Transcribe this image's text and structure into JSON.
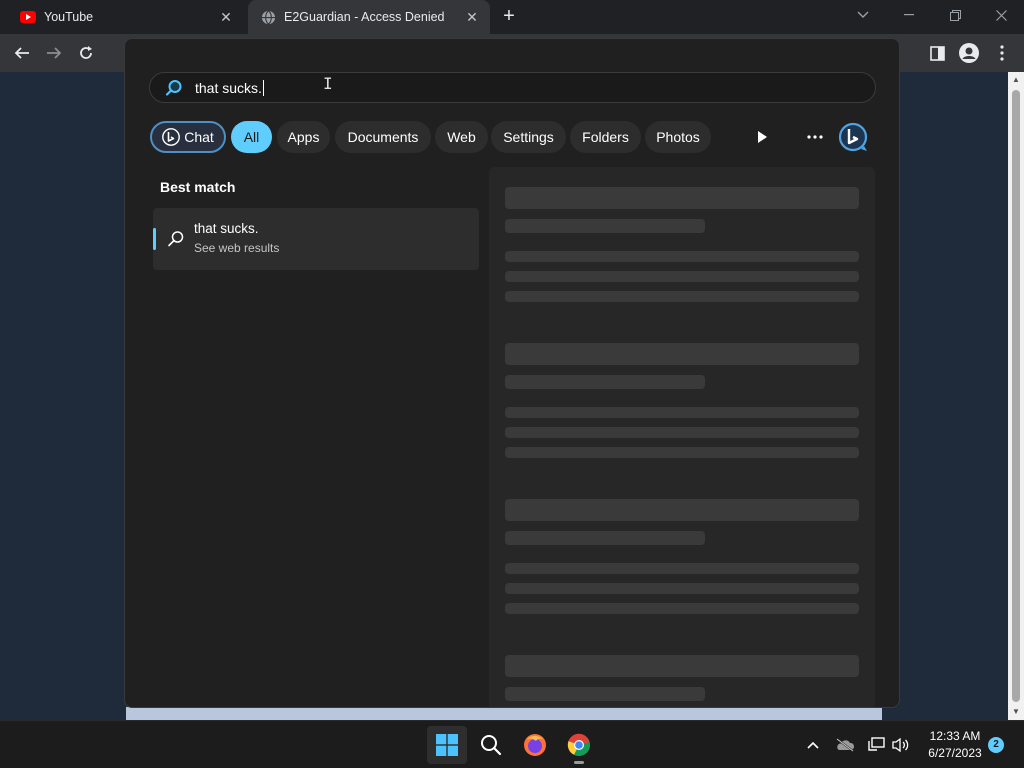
{
  "browser": {
    "tabs": [
      {
        "title": "YouTube",
        "favicon": "youtube-icon"
      },
      {
        "title": "E2Guardian - Access Denied",
        "favicon": "globe-icon"
      }
    ]
  },
  "search": {
    "query": "that sucks.",
    "filters": [
      "Chat",
      "All",
      "Apps",
      "Documents",
      "Web",
      "Settings",
      "Folders",
      "Photos"
    ],
    "active_filter": "All",
    "best_match_heading": "Best match",
    "result": {
      "title": "that sucks.",
      "subtitle": "See web results"
    }
  },
  "taskbar": {
    "pinned": [
      "start-icon",
      "search-icon",
      "firefox-icon",
      "chrome-icon"
    ],
    "time": "12:33 AM",
    "date": "6/27/2023",
    "notification_count": "2"
  },
  "colors": {
    "accent": "#60cdff",
    "flyout_bg": "#202020",
    "chip_bg": "#2d2d2d",
    "youtube_red": "#ff0000"
  }
}
